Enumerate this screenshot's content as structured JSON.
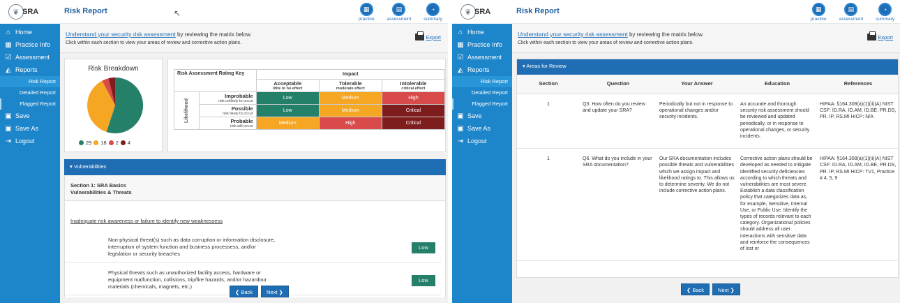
{
  "app": {
    "logo_text": "SRA",
    "page_title": "Risk Report",
    "top_nav": [
      {
        "label": "practice",
        "icon": "building-icon"
      },
      {
        "label": "assessment",
        "icon": "clipboard-icon"
      },
      {
        "label": "summary",
        "icon": "chart-icon"
      }
    ]
  },
  "sidebar": {
    "items": [
      {
        "label": "Home",
        "icon": "home-icon"
      },
      {
        "label": "Practice Info",
        "icon": "building-icon"
      },
      {
        "label": "Assessment",
        "icon": "checklist-icon"
      },
      {
        "label": "Reports",
        "icon": "chart-icon"
      }
    ],
    "sub_items": [
      "Risk Report",
      "Detailed Report",
      "Flagged Report"
    ],
    "bottom_items": [
      {
        "label": "Save",
        "icon": "floppy-icon"
      },
      {
        "label": "Save As",
        "icon": "floppy-icon"
      },
      {
        "label": "Logout",
        "icon": "logout-icon"
      }
    ]
  },
  "intro": {
    "link": "Understand your security risk assessment",
    "link_tail": " by reviewing the matrix below.",
    "line2": "Click within each section to view your areas of review and corrective action plans.",
    "export_label": "Export"
  },
  "breakdown": {
    "title": "Risk Breakdown",
    "counts": [
      "29",
      "18",
      "2",
      "4"
    ],
    "colors": [
      "#25806a",
      "#f5a623",
      "#d94a4a",
      "#7e1d1d"
    ]
  },
  "matrix": {
    "key_label": "Risk Assessment Rating Key",
    "impact_label": "Impact",
    "likelihood_label": "Likelihood",
    "columns": [
      {
        "name": "Acceptable",
        "desc": "little to no effect"
      },
      {
        "name": "Tolerable",
        "desc": "moderate effect"
      },
      {
        "name": "Intolerable",
        "desc": "critical effect"
      }
    ],
    "rows": [
      {
        "name": "Improbable",
        "desc": "risk unlikely to occur",
        "cells": [
          "Low",
          "Medium",
          "High"
        ]
      },
      {
        "name": "Possible",
        "desc": "risk likely to occur",
        "cells": [
          "Low",
          "Medium",
          "Critical"
        ]
      },
      {
        "name": "Probable",
        "desc": "risk will occur",
        "cells": [
          "Medium",
          "High",
          "Critical"
        ]
      }
    ]
  },
  "vulnerabilities": {
    "bar_label": "▾ Vulnerabilities",
    "section_line1": "Section 1: SRA Basics",
    "section_line2": "Vulnerabilities & Threats",
    "title": "Inadequate risk awareness or failure to identify new weaknessess",
    "items": [
      {
        "text": "Non-physical threat(s) such as data corruption or information disclosure, interruption of system function and business processess, and/or legislation or security breaches",
        "rating": "Low"
      },
      {
        "text": "Physical threats such as unauthorized facility access,  hardware or equipment malfunction, collisions, trip/fire hazards, and/or hazardour materials (chemicals, magnets, etc.)",
        "rating": "Low"
      }
    ]
  },
  "nav": {
    "back": "❮ Back",
    "next": "Next ❯"
  },
  "areas": {
    "bar_label": "▾ Areas for Review",
    "headers": [
      "Section",
      "Question",
      "Your Answer",
      "Education",
      "References"
    ],
    "rows": [
      {
        "section": "1",
        "question": "Q3. How often do you review and update your SRA?",
        "answer": "Periodically but not in response to operational changes and/or security incidents.",
        "education": "An accurate and thorough security risk assessment should be reviewed and updated periodically, or in response to operational changes, or security incidents.",
        "references": "HIPAA: §164.308(a)(1)(ii)(A) NIST CSF: ID.RA, ID.AM, ID.BE, PR.DS, PR. IP, RS.MI  HICP: N/A"
      },
      {
        "section": "1",
        "question": "Q6. What do you include in your SRA documentation?",
        "answer": "Our SRA documentation includes possible threats and vulnerabilities which we assign impact and likelihood ratings to. This allows us to determine severity. We do not include corrective action plans.",
        "education": "Corrective action plans should be developed as needed to mitigate identified security deficiencies according to which threats and vulnerabilities are most severe. Establish a data classification policy that categorizes data as, for example, Sensitive, Internal Use, or Public Use. Identify the types of records relevant to each category. Organizational policies should address all user interactions with sensitive data and reinforce the consequences of lost or",
        "references": "HIPAA: §164.308(a)(1)(ii)(A) NIST CSF: ID.RA, ID.AM, ID.BE, PR.DS, PR. IP, RS.MI  HICP: TV1, Practice # 4, 5, 9"
      }
    ]
  }
}
